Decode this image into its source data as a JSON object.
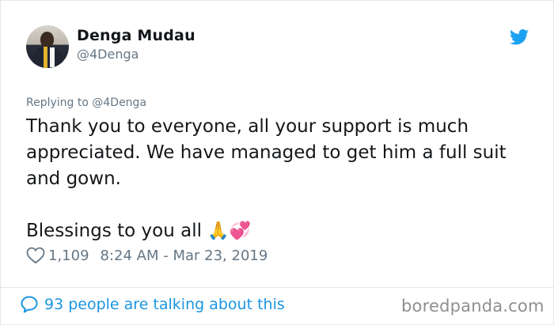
{
  "author": {
    "name": "Denga Mudau",
    "handle": "@4Denga"
  },
  "icons": {
    "platform": "twitter-bird-icon",
    "like": "heart-outline-icon",
    "reply": "speech-bubble-icon"
  },
  "colors": {
    "twitter_blue": "#1da1f2",
    "link_blue": "#1b95e0",
    "muted_gray": "#657786",
    "text": "#14171a"
  },
  "tweet": {
    "replying_to": "Replying to @4Denga",
    "paragraph_1": "Thank you to everyone, all your support is much appreciated. We have managed to get him a full suit and gown.",
    "paragraph_2": "Blessings to you all",
    "emojis": "🙏💞",
    "likes": "1,109",
    "timestamp": "8:24 AM - Mar 23, 2019"
  },
  "footer": {
    "talking": "93 people are talking about this"
  },
  "watermark": "boredpanda.com"
}
